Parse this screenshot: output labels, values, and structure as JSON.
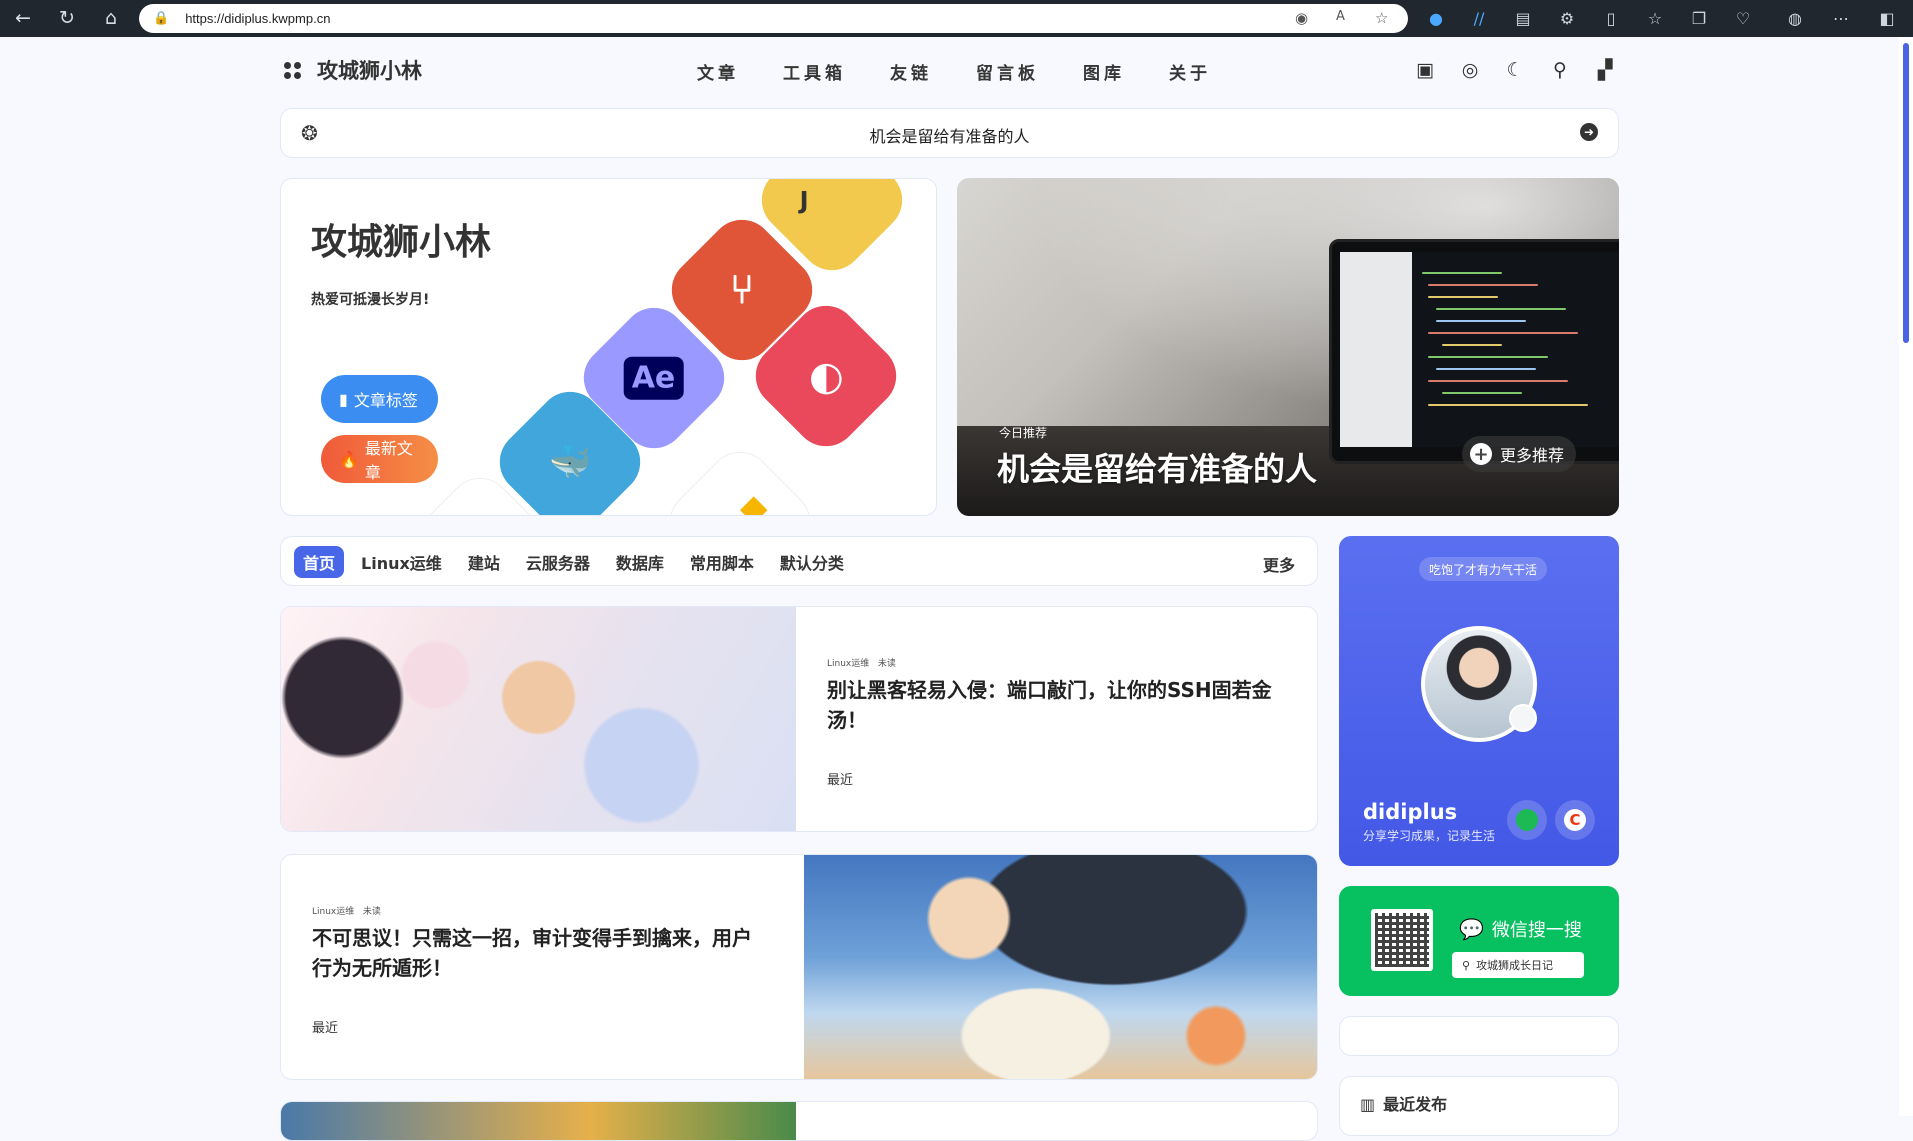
{
  "browser": {
    "url": "https://didiplus.kwpmp.cn"
  },
  "site": {
    "brand": "攻城狮小林",
    "menu": [
      "文章",
      "工具箱",
      "友链",
      "留言板",
      "图库",
      "关于"
    ]
  },
  "announcement": "机会是留给有准备的人",
  "hero": {
    "title": "攻城狮小林",
    "subtitle": "热爱可抵漫长岁月!",
    "btn_tags": "文章标签",
    "btn_latest": "最新文章",
    "tiles": [
      "Ae",
      "J"
    ]
  },
  "featured": {
    "tag": "今日推荐",
    "title": "机会是留给有准备的人",
    "more": "更多推荐"
  },
  "categories": {
    "tabs": [
      "首页",
      "Linux运维",
      "建站",
      "云服务器",
      "数据库",
      "常用脚本",
      "默认分类"
    ],
    "more": "更多"
  },
  "posts": [
    {
      "category": "Linux运维",
      "status": "未读",
      "title": "别让黑客轻易入侵：端口敲门，让你的SSH固若金汤！",
      "time": "最近"
    },
    {
      "category": "Linux运维",
      "status": "未读",
      "title": "不可思议！只需这一招，审计变得手到擒来，用户行为无所遁形！",
      "time": "最近"
    }
  ],
  "profile": {
    "badge": "吃饱了才有力气干活",
    "name": "didiplus",
    "motto": "分享学习成果，记录生活"
  },
  "wechat": {
    "title": "微信搜一搜",
    "search": "攻城狮成长日记"
  },
  "recent": {
    "title": "最近发布"
  }
}
